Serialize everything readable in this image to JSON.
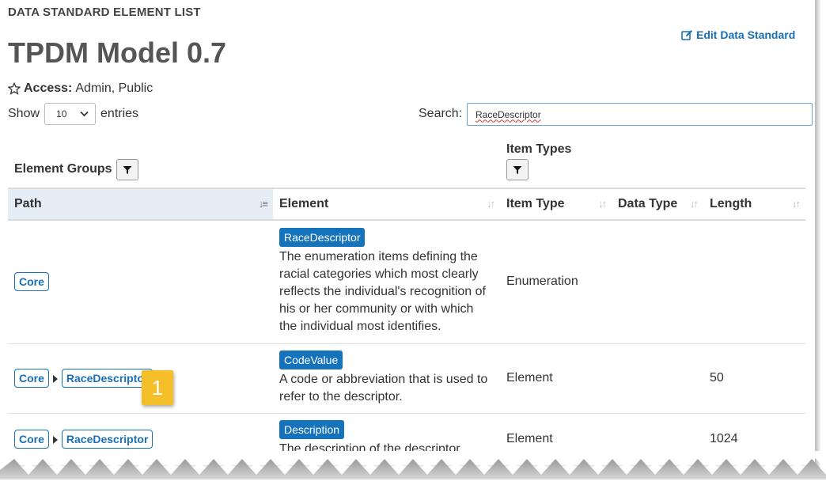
{
  "header": {
    "subtitle": "DATA STANDARD ELEMENT LIST",
    "title": "TPDM Model 0.7",
    "edit_link": "Edit Data Standard",
    "access_label": "Access:",
    "access_value": "Admin, Public"
  },
  "controls": {
    "show_label": "Show",
    "entries_value": "10",
    "entries_label": "entries",
    "search_label": "Search:",
    "search_value": "RaceDescriptor"
  },
  "filters": {
    "element_groups": "Element Groups",
    "item_types": "Item Types"
  },
  "table": {
    "columns": [
      "Path",
      "Element",
      "Item Type",
      "Data Type",
      "Length"
    ],
    "rows": [
      {
        "path": [
          "Core"
        ],
        "element": "RaceDescriptor",
        "description": "The enumeration items defining the racial categories which most clearly reflects the individual's recognition of his or her community or with which the individual most identifies.",
        "item_type": "Enumeration",
        "data_type": "",
        "length": ""
      },
      {
        "path": [
          "Core",
          "RaceDescriptor"
        ],
        "element": "CodeValue",
        "description": "A code or abbreviation that is used to refer to the descriptor.",
        "item_type": "Element",
        "data_type": "",
        "length": "50"
      },
      {
        "path": [
          "Core",
          "RaceDescriptor"
        ],
        "element": "Description",
        "description": "The description of the descriptor.",
        "item_type": "Element",
        "data_type": "",
        "length": "1024"
      }
    ]
  },
  "callout": "1",
  "colors": {
    "link_blue": "#1a6fb5",
    "badge_blue": "#1573bb",
    "callout_yellow": "#f5bf2a",
    "sorted_header": "#e5eef7"
  },
  "icons": [
    "edit-icon",
    "star-outline-icon",
    "chevron-down-icon",
    "filter-icon",
    "sort-icon",
    "sort-ascending-icon",
    "caret-right-icon"
  ]
}
